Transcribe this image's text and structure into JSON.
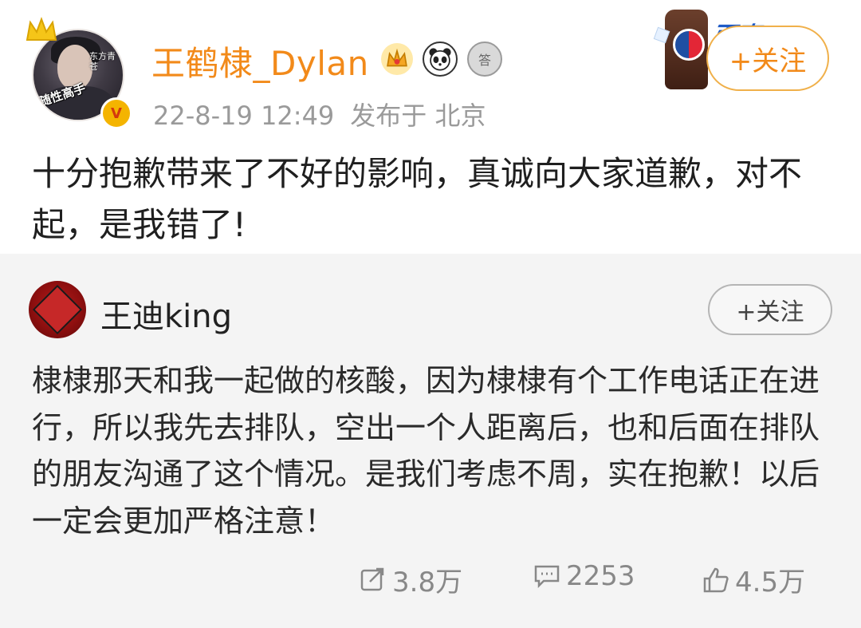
{
  "post": {
    "username": "王鹤棣_Dylan",
    "avatar_sticker": "随性高手",
    "avatar_sticker_small": "东方青苍",
    "verified_icon": "v-badge-icon",
    "badge_icons": [
      "crown-badge-icon",
      "panda-badge-icon",
      "medal-badge-icon"
    ],
    "badge_medal_text": "答",
    "datetime": "22-8-19 12:49",
    "published_from": "发布于 北京",
    "follow_label": "+关注",
    "text": "十分抱歉带来了不好的影响，真诚向大家道歉，对不起，是我错了!",
    "ad_text": "百事"
  },
  "repost": {
    "username": "王迪king",
    "follow_label": "+关注",
    "text": "棣棣那天和我一起做的核酸，因为棣棣有个工作电话正在进行，所以我先去排队，空出一个人距离后，也和后面在排队的朋友沟通了这个情况。是我们考虑不周，实在抱歉！以后一定会更加严格注意！",
    "actions": {
      "repost_count": "3.8万",
      "comment_count": "2253",
      "like_count": "4.5万"
    }
  },
  "colors": {
    "username": "#f28a1a",
    "meta": "#9a9a9a",
    "repost_bg": "#f4f4f4"
  }
}
